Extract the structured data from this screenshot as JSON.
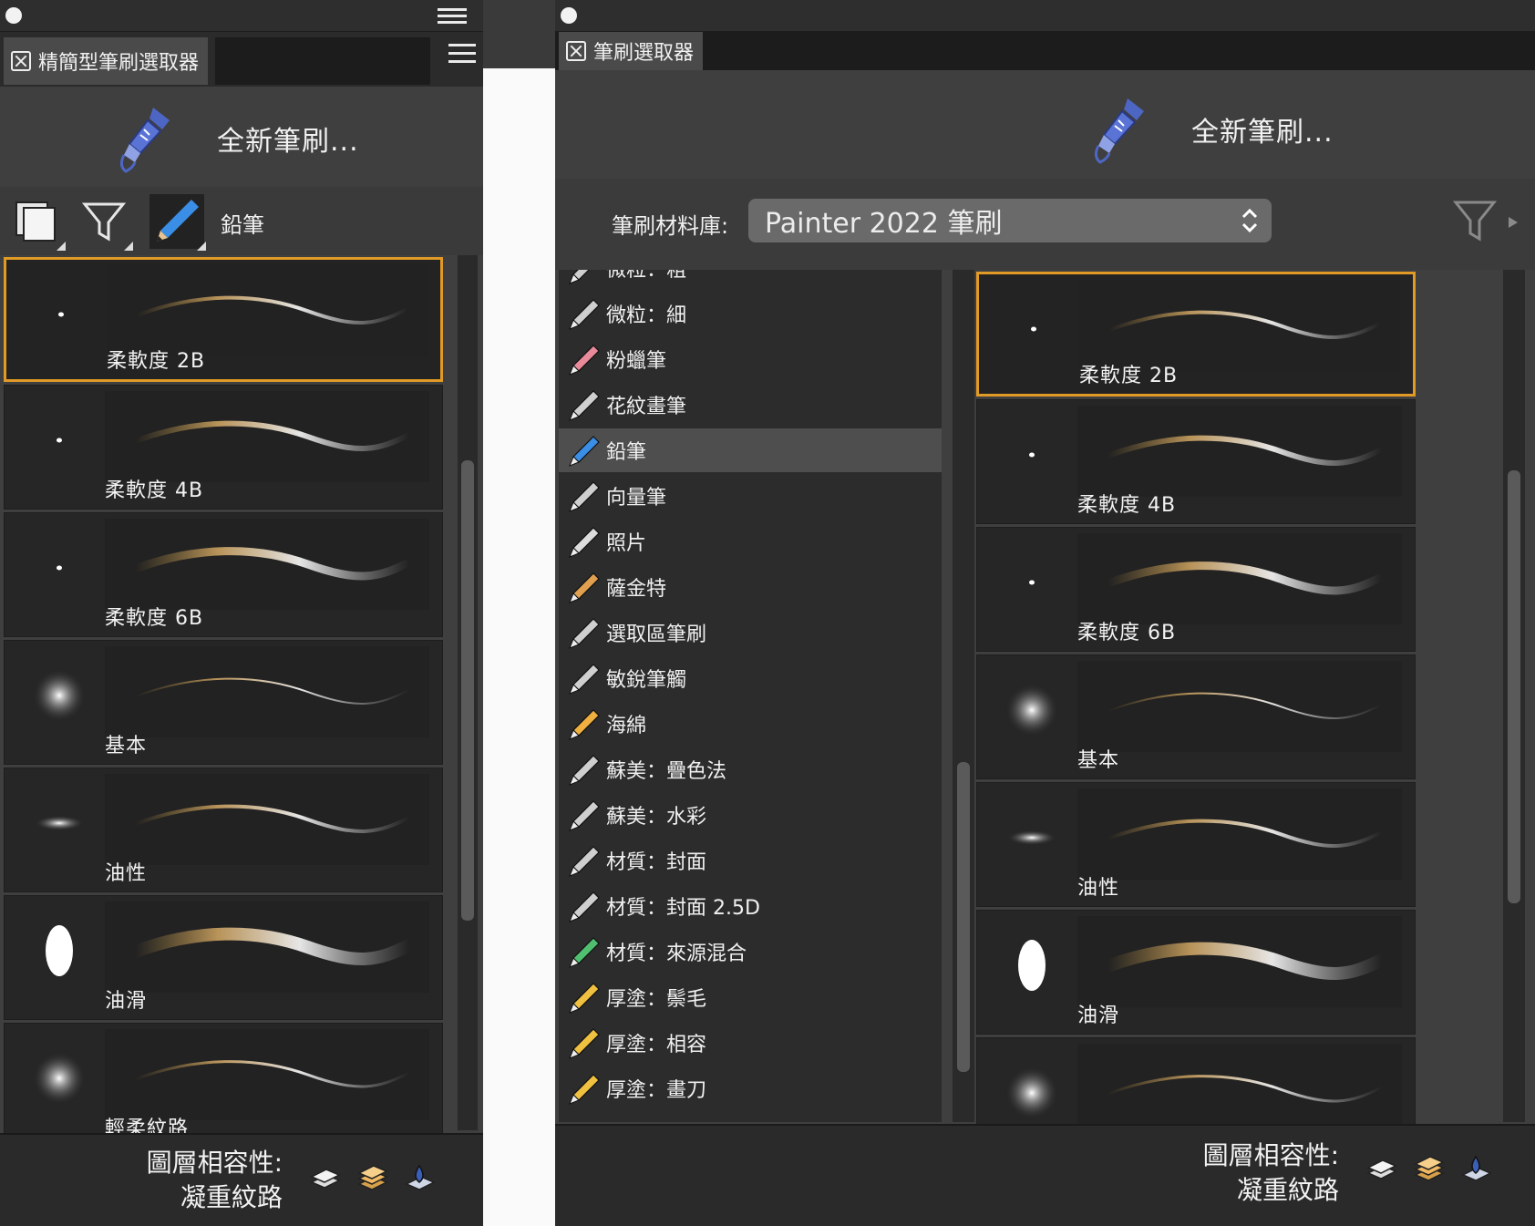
{
  "left": {
    "tab_label": "精簡型筆刷選取器",
    "new_brush_label": "全新筆刷...",
    "category_label": "鉛筆",
    "variants": [
      {
        "name": "柔軟度 2B",
        "selected": true,
        "dab": "small-dot"
      },
      {
        "name": "柔軟度 4B",
        "selected": false,
        "dab": "small-dot"
      },
      {
        "name": "柔軟度 6B",
        "selected": false,
        "dab": "small-dot"
      },
      {
        "name": "基本",
        "selected": false,
        "dab": "soft-circle"
      },
      {
        "name": "油性",
        "selected": false,
        "dab": "flat-oval"
      },
      {
        "name": "油滑",
        "selected": false,
        "dab": "tall-oval"
      },
      {
        "name": "輕柔紋路",
        "selected": false,
        "dab": "soft-circle"
      }
    ],
    "compat_title": "圖層相容性:",
    "compat_value": "凝重紋路"
  },
  "right": {
    "tab_label": "筆刷選取器",
    "new_brush_label": "全新筆刷...",
    "library_label": "筆刷材料庫:",
    "library_value": "Painter 2022 筆刷",
    "categories": [
      {
        "label": "微粒：粗",
        "icon": "particle-icon"
      },
      {
        "label": "微粒：細",
        "icon": "particle-fine-icon"
      },
      {
        "label": "粉蠟筆",
        "icon": "pastel-icon"
      },
      {
        "label": "花紋畫筆",
        "icon": "pattern-pen-icon"
      },
      {
        "label": "鉛筆",
        "icon": "pencil-icon",
        "selected": true
      },
      {
        "label": "向量筆",
        "icon": "vector-pen-icon"
      },
      {
        "label": "照片",
        "icon": "photo-icon"
      },
      {
        "label": "薩金特",
        "icon": "sargent-icon"
      },
      {
        "label": "選取區筆刷",
        "icon": "selection-brush-icon"
      },
      {
        "label": "敏銳筆觸",
        "icon": "sharp-stroke-icon"
      },
      {
        "label": "海綿",
        "icon": "sponge-icon"
      },
      {
        "label": "蘇美：疊色法",
        "icon": "sumi-layer-icon"
      },
      {
        "label": "蘇美：水彩",
        "icon": "sumi-watercolor-icon"
      },
      {
        "label": "材質：封面",
        "icon": "texture-cover-icon"
      },
      {
        "label": "材質：封面 2.5D",
        "icon": "texture-cover-25d-icon"
      },
      {
        "label": "材質：來源混合",
        "icon": "texture-blend-icon"
      },
      {
        "label": "厚塗：鬃毛",
        "icon": "impasto-bristle-icon"
      },
      {
        "label": "厚塗：相容",
        "icon": "impasto-compat-icon"
      },
      {
        "label": "厚塗：畫刀",
        "icon": "impasto-knife-icon"
      }
    ],
    "variants": [
      {
        "name": "柔軟度 2B",
        "selected": true,
        "dab": "small-dot"
      },
      {
        "name": "柔軟度 4B",
        "selected": false,
        "dab": "small-dot"
      },
      {
        "name": "柔軟度 6B",
        "selected": false,
        "dab": "small-dot"
      },
      {
        "name": "基本",
        "selected": false,
        "dab": "soft-circle"
      },
      {
        "name": "油性",
        "selected": false,
        "dab": "flat-oval"
      },
      {
        "name": "油滑",
        "selected": false,
        "dab": "tall-oval"
      },
      {
        "name": "",
        "selected": false,
        "dab": "soft-circle"
      }
    ],
    "compat_title": "圖層相容性:",
    "compat_value": "凝重紋路"
  },
  "colors": {
    "selection_border": "#e09a25",
    "brush_icon": "#4d66c4",
    "panel_bg": "#3f3f3f"
  }
}
